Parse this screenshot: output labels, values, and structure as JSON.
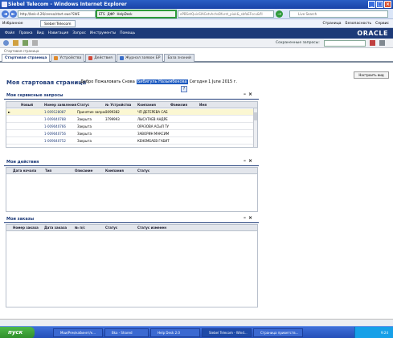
{
  "window": {
    "title": "Siebel Telecom - Windows Internet Explorer"
  },
  "address": {
    "url": "http://bnk-4.26/censo/start.swe?SWE",
    "url_tail": "ePBSetQuivSIAGstvhchsBfurst_piuk&_sbfaEFscu&fll",
    "toolbar_items": [
      "ETS",
      "ДФР",
      "HelpDesk"
    ],
    "search_placeholder": "Live Search"
  },
  "favbar": {
    "favorites": "Избранное",
    "tab": "Siebel Telecom",
    "commands": [
      "Страница",
      "Безопасность",
      "Сервис"
    ]
  },
  "menu": {
    "items": [
      "Файл",
      "Правка",
      "Вид",
      "Навигация",
      "Запрос",
      "Инструменты",
      "Помощь"
    ],
    "brand": "ORACLE"
  },
  "toolbar": {
    "saved_queries_label": "Сохраненные запросы:"
  },
  "breadcrumb": "Стартовая страница",
  "tabs": [
    {
      "label": "Стартовая страница",
      "icon_color": "#ffffff",
      "active": true
    },
    {
      "label": "Устройства",
      "icon_color": "#e08a2a",
      "active": false
    },
    {
      "label": "Действия",
      "icon_color": "#d14a3a",
      "active": false
    },
    {
      "label": "Журнал заявок БР",
      "icon_color": "#3a6ec8",
      "active": false
    },
    {
      "label": "База знаний",
      "icon_color": "#888888",
      "active": false
    }
  ],
  "home": {
    "title": "Моя стартовая страница",
    "welcome_prefix": "Добро Пожаловать Снова",
    "user_name": "Бибигуль Назымбекова",
    "date_text": "Сегодня 1 June 2015 г.",
    "setup_button": "Настроить вид"
  },
  "service_requests": {
    "title": "Мои сервисные запросы",
    "columns": [
      "Новый",
      "Номер заявления",
      "Статус",
      "№ Устройства",
      "Компания",
      "Фамилия",
      "Имя"
    ],
    "rows": [
      {
        "number": "1-009128087",
        "status": "Принятие запрос",
        "device": "3099382",
        "company": "ЧП ДЕГЕРЕВА САБ"
      },
      {
        "number": "1-009040788",
        "status": "Закрыта",
        "device": "3799993",
        "company": "ЛЫСАТАЕВ АНДРЕ"
      },
      {
        "number": "1-009040766",
        "status": "Закрыта",
        "device": "",
        "company": "ОРАЗОВА АСЫЛ ТУ"
      },
      {
        "number": "1-009040756",
        "status": "Закрыта",
        "device": "",
        "company": "ЗАВОРИН МАКСИМ"
      },
      {
        "number": "1-009040752",
        "status": "Закрыта",
        "device": "",
        "company": "КЕНЕМБАЕВ ГАБИТ"
      }
    ]
  },
  "actions": {
    "title": "Мои действия",
    "columns": [
      "Дата начала",
      "Тип",
      "Описание",
      "Компания",
      "Статус"
    ]
  },
  "orders": {
    "title": "Мои заказы",
    "columns": [
      "Номер заказа",
      "Дата заказа",
      "№ п/с",
      "Статус",
      "Статус изменен"
    ]
  },
  "taskbar": {
    "start": "пуск",
    "tasks": [
      "Мои/Рем/кабинет/к...",
      "Bka - Shared",
      "Help Desk 2.0",
      "Siebel Telecom - Wind...",
      "Страница приветств..."
    ],
    "clock": "9:24"
  }
}
